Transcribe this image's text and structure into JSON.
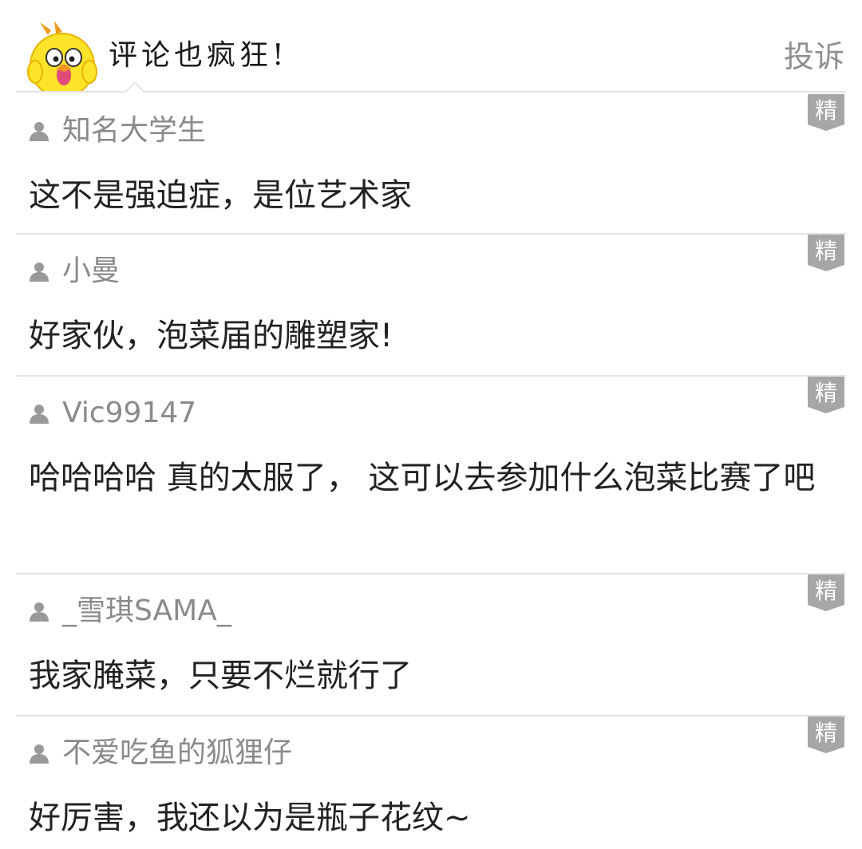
{
  "header": {
    "title": "评论也疯狂!",
    "report_label": "投诉",
    "mascot_icon": "chick-mascot-icon"
  },
  "colors": {
    "divider": "#e3e3e3",
    "username": "#8a8a8a",
    "report": "#8f8f8f",
    "badge_bg": "#a6a6a6",
    "badge_text": "#ffffff",
    "text": "#222222"
  },
  "comments": [
    {
      "username": "知名大学生",
      "text": "这不是强迫症，是位艺术家",
      "badge": "精"
    },
    {
      "username": "小曼",
      "text": "好家伙，泡菜届的雕塑家!",
      "badge": "精"
    },
    {
      "username": "Vic99147",
      "text": "哈哈哈哈 真的太服了， 这可以去参加什么泡菜比赛了吧",
      "badge": "精"
    },
    {
      "username": "_雪琪SAMA_",
      "text": "我家腌菜，只要不烂就行了",
      "badge": "精"
    },
    {
      "username": "不爱吃鱼的狐狸仔",
      "text": "好厉害，我还以为是瓶子花纹~",
      "badge": "精"
    }
  ]
}
